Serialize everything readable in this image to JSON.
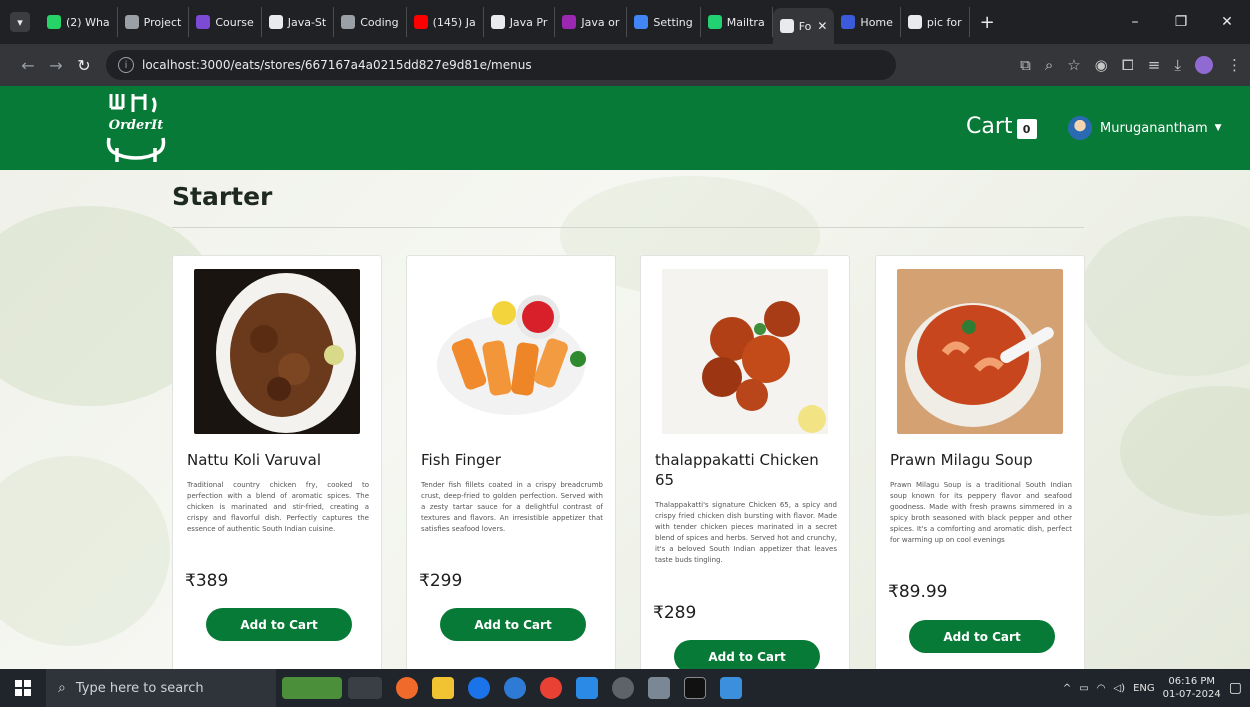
{
  "browser": {
    "tabs": [
      {
        "label": "(2) Wha",
        "color": "#25d366"
      },
      {
        "label": "Project",
        "color": "#9aa0a6"
      },
      {
        "label": "Course",
        "color": "#7b4bd6"
      },
      {
        "label": "Java-St",
        "color": "#e8eaed"
      },
      {
        "label": "Coding",
        "color": "#9aa0a6"
      },
      {
        "label": "(145) Ja",
        "color": "#ff0000"
      },
      {
        "label": "Java Pr",
        "color": "#e8eaed"
      },
      {
        "label": "Java or",
        "color": "#9c27b0"
      },
      {
        "label": "Setting",
        "color": "#4285f4"
      },
      {
        "label": "Mailtra",
        "color": "#22d172"
      },
      {
        "label": "Fo",
        "color": "#e8eaed",
        "active": true
      },
      {
        "label": "Home",
        "color": "#3b5bdb"
      },
      {
        "label": "pic for",
        "color": "#e8eaed"
      }
    ],
    "url": "localhost:3000/eats/stores/667167a4a0215dd827e9d81e/menus"
  },
  "header": {
    "logo_text": "OrderIt",
    "cart_label": "Cart",
    "cart_count": "0",
    "user_name": "Muruganantham"
  },
  "section": {
    "title": "Starter"
  },
  "items": [
    {
      "name": "Nattu Koli Varuval",
      "description": "Traditional country chicken fry, cooked to perfection with a blend of aromatic spices. The chicken is marinated and stir-fried, creating a crispy and flavorful dish. Perfectly captures the essence of authentic South Indian cuisine.",
      "price": "₹389",
      "button": "Add to Cart"
    },
    {
      "name": "Fish Finger",
      "description": "Tender fish fillets coated in a crispy breadcrumb crust, deep-fried to golden perfection. Served with a zesty tartar sauce for a delightful contrast of textures and flavors. An irresistible appetizer that satisfies seafood lovers.",
      "price": "₹299",
      "button": "Add to Cart"
    },
    {
      "name": "thalappakatti Chicken 65",
      "description": "Thalappakatti's signature Chicken 65, a spicy and crispy fried chicken dish bursting with flavor. Made with tender chicken pieces marinated in a secret blend of spices and herbs. Served hot and crunchy, it's a beloved South Indian appetizer that leaves taste buds tingling.",
      "price": "₹289",
      "button": "Add to Cart"
    },
    {
      "name": "Prawn Milagu Soup",
      "description": "Prawn Milagu Soup is a traditional South Indian soup known for its peppery flavor and seafood goodness. Made with fresh prawns simmered in a spicy broth seasoned with black pepper and other spices. It's a comforting and aromatic dish, perfect for warming up on cool evenings",
      "price": "₹89.99",
      "button": "Add to Cart"
    }
  ],
  "taskbar": {
    "search_placeholder": "Type here to search",
    "lang": "ENG",
    "time": "06:16 PM",
    "date": "01-07-2024"
  }
}
